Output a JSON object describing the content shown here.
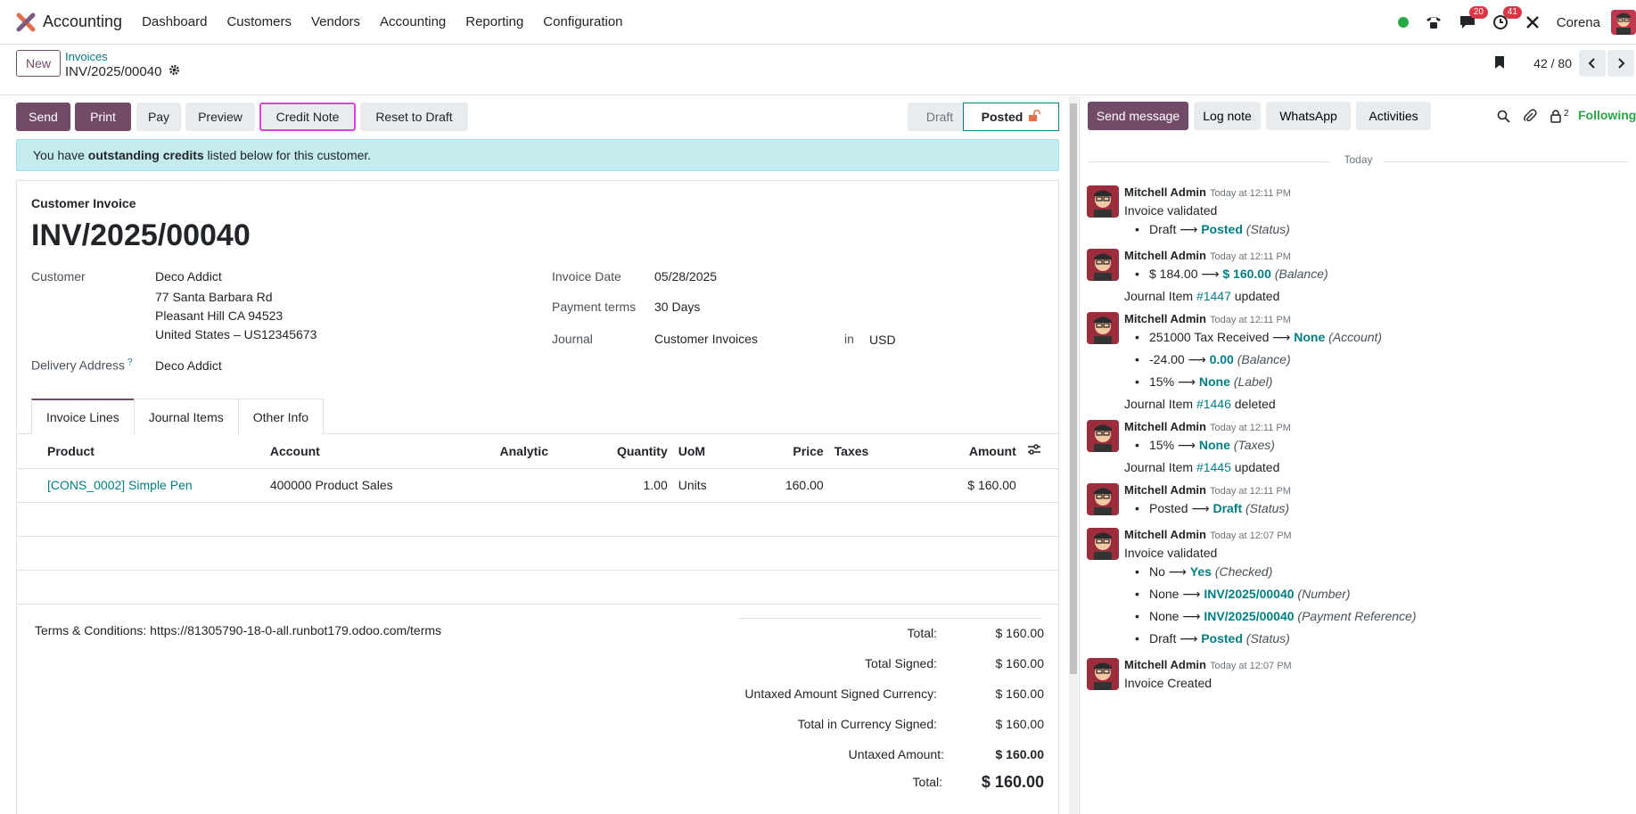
{
  "nav": {
    "app_name": "Accounting",
    "menu": [
      "Dashboard",
      "Customers",
      "Vendors",
      "Accounting",
      "Reporting",
      "Configuration"
    ],
    "messages_badge": "20",
    "activities_badge": "41",
    "company": "Corena"
  },
  "control": {
    "new_label": "New",
    "breadcrumb_parent": "Invoices",
    "breadcrumb_current": "INV/2025/00040",
    "pager": "42 / 80"
  },
  "actions": {
    "send": "Send",
    "print": "Print",
    "pay": "Pay",
    "preview": "Preview",
    "credit_note": "Credit Note",
    "reset": "Reset to Draft",
    "stage_draft": "Draft",
    "stage_posted": "Posted"
  },
  "alert": {
    "pre": "You have ",
    "bold": "outstanding credits",
    "post": " listed below for this customer."
  },
  "invoice": {
    "type": "Customer Invoice",
    "name": "INV/2025/00040",
    "customer_label": "Customer",
    "customer": "Deco Addict",
    "address1": "77 Santa Barbara Rd",
    "address2": "Pleasant Hill CA 94523",
    "address3": "United States – US12345673",
    "delivery_label": "Delivery Address",
    "delivery_help": "?",
    "delivery": "Deco Addict",
    "date_label": "Invoice Date",
    "date": "05/28/2025",
    "terms_label": "Payment terms",
    "terms": "30 Days",
    "journal_label": "Journal",
    "journal": "Customer Invoices",
    "in_label": "in",
    "currency": "USD"
  },
  "tabs": [
    "Invoice Lines",
    "Journal Items",
    "Other Info"
  ],
  "lines": {
    "headers": {
      "product": "Product",
      "account": "Account",
      "analytic": "Analytic",
      "quantity": "Quantity",
      "uom": "UoM",
      "price": "Price",
      "taxes": "Taxes",
      "amount": "Amount"
    },
    "rows": [
      {
        "product": "[CONS_0002] Simple Pen",
        "account": "400000 Product Sales",
        "analytic": "",
        "quantity": "1.00",
        "uom": "Units",
        "price": "160.00",
        "taxes": "",
        "amount": "$ 160.00"
      }
    ]
  },
  "footer": {
    "terms": "Terms & Conditions: https://81305790-18-0-all.runbot179.odoo.com/terms",
    "totals": [
      {
        "label": "Total:",
        "value": "$ 160.00"
      },
      {
        "label": "Total Signed:",
        "value": "$ 160.00"
      },
      {
        "label": "Untaxed Amount Signed Currency:",
        "value": "$ 160.00"
      },
      {
        "label": "Total in Currency Signed:",
        "value": "$ 160.00"
      },
      {
        "label": "Untaxed Amount:",
        "value": "$ 160.00"
      },
      {
        "label": "Total:",
        "value": "$ 160.00"
      }
    ]
  },
  "chatter": {
    "send_message": "Send message",
    "log_note": "Log note",
    "whatsapp": "WhatsApp",
    "activities": "Activities",
    "followers_count": "2",
    "following": "Following",
    "today": "Today",
    "author": "Mitchell Admin",
    "messages": [
      {
        "time": "Today at 12:11 PM",
        "title": "Invoice validated",
        "changes": [
          {
            "old": "Draft",
            "new": "Posted",
            "field": "(Status)"
          }
        ]
      },
      {
        "time": "Today at 12:11 PM",
        "changes": [
          {
            "old": "$ 184.00",
            "new": "$ 160.00",
            "field": "(Balance)"
          }
        ],
        "after": {
          "pre": "Journal Item ",
          "link": "#1447",
          "post": " updated"
        }
      },
      {
        "time": "Today at 12:11 PM",
        "changes": [
          {
            "old": "251000 Tax Received",
            "new": "None",
            "field": "(Account)"
          },
          {
            "old": "-24.00",
            "new": "0.00",
            "field": "(Balance)"
          },
          {
            "old": "15%",
            "new": "None",
            "field": "(Label)"
          }
        ],
        "after": {
          "pre": "Journal Item ",
          "link": "#1446",
          "post": " deleted"
        }
      },
      {
        "time": "Today at 12:11 PM",
        "changes": [
          {
            "old": "15%",
            "new": "None",
            "field": "(Taxes)"
          }
        ],
        "after": {
          "pre": "Journal Item ",
          "link": "#1445",
          "post": " updated"
        }
      },
      {
        "time": "Today at 12:11 PM",
        "changes": [
          {
            "old": "Posted",
            "new": "Draft",
            "field": "(Status)"
          }
        ]
      },
      {
        "time": "Today at 12:07 PM",
        "title": "Invoice validated",
        "changes": [
          {
            "old": "No",
            "new": "Yes",
            "field": "(Checked)"
          },
          {
            "old": "None",
            "new": "INV/2025/00040",
            "field": "(Number)"
          },
          {
            "old": "None",
            "new": "INV/2025/00040",
            "field": "(Payment Reference)"
          },
          {
            "old": "Draft",
            "new": "Posted",
            "field": "(Status)"
          }
        ]
      },
      {
        "time": "Today at 12:07 PM",
        "title": "Invoice Created"
      }
    ]
  }
}
